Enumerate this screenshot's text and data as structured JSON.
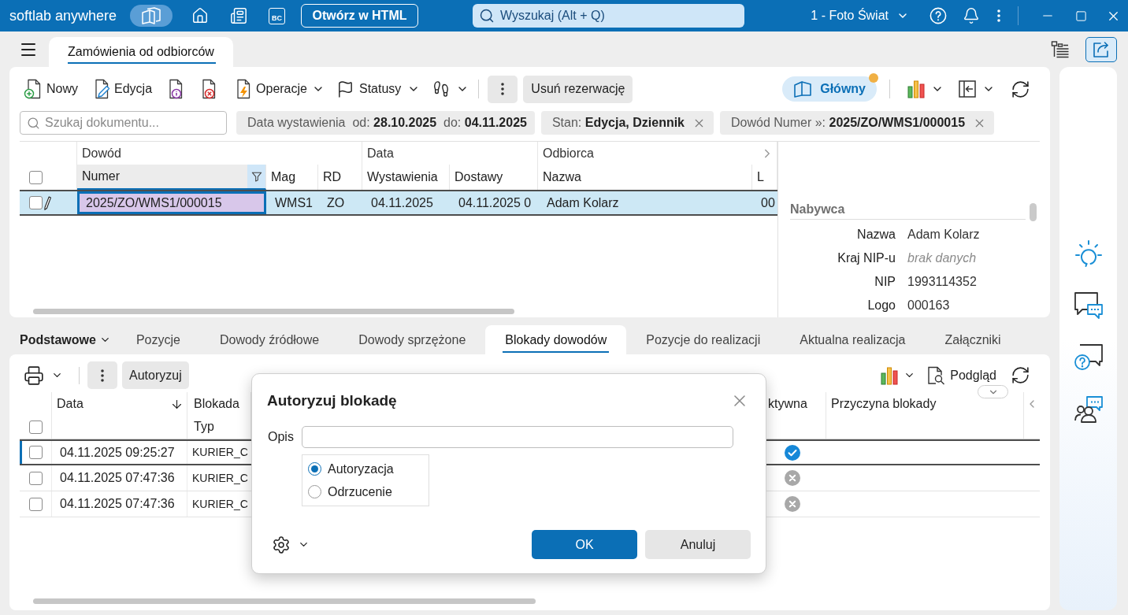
{
  "title_bar": {
    "app_name": "softlab anywhere",
    "bc_badge": "BC",
    "open_html_button": "Otwórz w HTML",
    "search": {
      "placeholder": "Wyszukaj (Alt + Q)"
    },
    "company": "1 - Foto Świat"
  },
  "document_tabs": [
    {
      "label": "Zamówienia od odbiorców",
      "selected": true
    }
  ],
  "toolbar": {
    "new_button": "Nowy",
    "edit_button": "Edycja",
    "operations_menu": "Operacje",
    "statuses_menu": "Statusy",
    "remove_reservation_button": "Usuń rezerwację",
    "view_button": {
      "label": "Główny",
      "notification": true
    }
  },
  "filters": {
    "search": {
      "placeholder": "Szukaj dokumentu..."
    },
    "chips": [
      {
        "text": "Data wystawienia  od: **28.10.2025**  do: **04.11.2025**",
        "removable": false
      },
      {
        "text": "Stan: **Edycja, Dziennik**",
        "removable": true
      },
      {
        "text": "Dowód Numer »: **2025/ZO/WMS1/000015**",
        "removable": true
      }
    ]
  },
  "documents_grid": {
    "header_checkbox": {
      "checked": false
    },
    "column_groups": [
      {
        "label": "Dowód",
        "columns": [
          {
            "label": "Numer",
            "filtered": true
          },
          {
            "label": "Mag",
            "filtered": false
          },
          {
            "label": "RD",
            "filtered": false
          }
        ]
      },
      {
        "label": "Data",
        "columns": [
          {
            "label": "Wystawienia",
            "filtered": false
          },
          {
            "label": "Dostawy",
            "filtered": false
          }
        ]
      },
      {
        "label": "Odbiorca",
        "columns": [
          {
            "label": "Nazwa",
            "filtered": false
          },
          {
            "label": "L",
            "filtered": false
          }
        ]
      }
    ],
    "rows": [
      {
        "selected": true,
        "checked": false,
        "editing": true,
        "cells": [
          {
            "text": "2025/ZO/WMS1/000015",
            "focused": true
          },
          {
            "text": "WMS1",
            "focused": false
          },
          {
            "text": "ZO",
            "focused": false
          },
          {
            "text": "04.11.2025",
            "focused": false
          },
          {
            "text": "04.11.2025 0",
            "focused": false
          },
          {
            "text": "Adam Kolarz",
            "focused": false
          },
          {
            "text": "00",
            "focused": false
          }
        ]
      }
    ]
  },
  "details": {
    "title": "Nabywca",
    "fields": [
      {
        "label": "Nazwa",
        "value": "Adam Kolarz",
        "missing": false
      },
      {
        "label": "Kraj NIP-u",
        "value": "brak danych",
        "missing": true
      },
      {
        "label": "NIP",
        "value": "1993114352",
        "missing": false
      },
      {
        "label": "Logo",
        "value": "000163",
        "missing": false
      }
    ]
  },
  "section_tabs": {
    "menu": "Podstawowe",
    "tabs": [
      {
        "label": "Pozycje",
        "selected": false
      },
      {
        "label": "Dowody źródłowe",
        "selected": false
      },
      {
        "label": "Dowody sprzężone",
        "selected": false
      },
      {
        "label": "Blokady dowodów",
        "selected": true
      },
      {
        "label": "Pozycje do realizacji",
        "selected": false
      },
      {
        "label": "Aktualna realizacja",
        "selected": false
      },
      {
        "label": "Załączniki",
        "selected": false
      }
    ]
  },
  "locks_toolbar": {
    "authorize_button": "Autoryzuj",
    "preview_button": "Podgląd"
  },
  "locks_table": {
    "header_checkbox": {
      "checked": false
    },
    "columns": [
      {
        "label": "Data",
        "sorted": true
      },
      {
        "label": "Blokada",
        "sublabel": "Typ",
        "sorted": false
      },
      {
        "label": "ktywna",
        "sorted": false
      },
      {
        "label": "Przyczyna blokady",
        "sorted": false
      }
    ],
    "rows": [
      {
        "selected": true,
        "checked": false,
        "date": "04.11.2025 09:25:27",
        "type": "KURIER_C",
        "active": true
      },
      {
        "selected": false,
        "checked": false,
        "date": "04.11.2025 07:47:36",
        "type": "KURIER_C",
        "active": false
      },
      {
        "selected": false,
        "checked": false,
        "date": "04.11.2025 07:47:36",
        "type": "KURIER_C",
        "active": false
      }
    ]
  },
  "dialog": {
    "title": "Autoryzuj blokadę",
    "description_field": {
      "label": "Opis"
    },
    "options": [
      {
        "label": "Autoryzacja",
        "selected": true
      },
      {
        "label": "Odrzucenie",
        "selected": false
      }
    ],
    "ok_button": "OK",
    "cancel_button": "Anuluj"
  }
}
